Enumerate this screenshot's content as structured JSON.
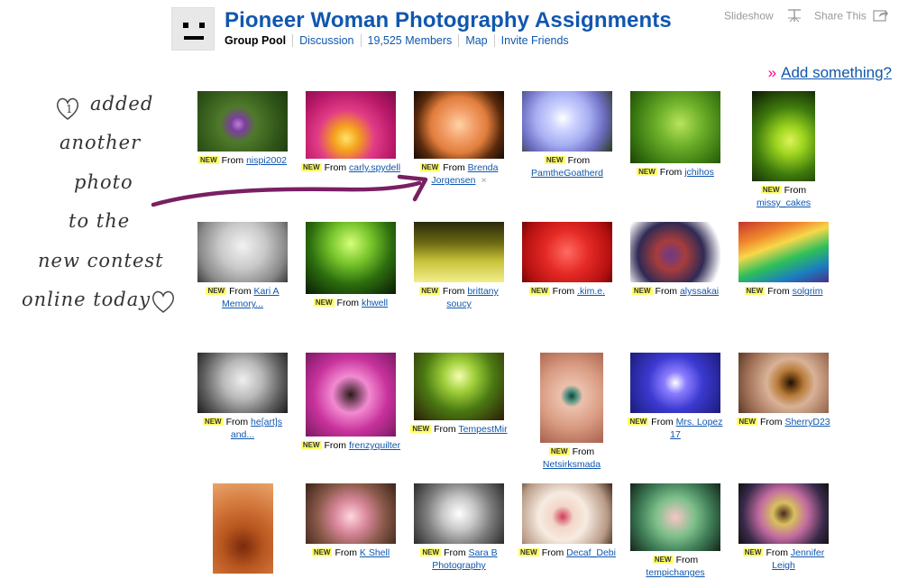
{
  "header": {
    "title": "Pioneer Woman Photography Assignments",
    "nav": [
      "Group Pool",
      "Discussion",
      "19,525 Members",
      "Map",
      "Invite Friends"
    ],
    "slideshow": "Slideshow",
    "share": "Share This"
  },
  "add_something": "Add something?",
  "handwritten_note": [
    "added",
    "another",
    "photo",
    "to the",
    "new contest",
    "online today"
  ],
  "labels": {
    "new": "NEW",
    "from": "From"
  },
  "photos": [
    {
      "user": "nispi2002"
    },
    {
      "user": "carly.spydell"
    },
    {
      "user": "Brenda Jorgensen"
    },
    {
      "user": "PamtheGoatherd"
    },
    {
      "user": "jchihos"
    },
    {
      "user": "missy_cakes"
    },
    {
      "user": "Kari A Memory..."
    },
    {
      "user": "khwell"
    },
    {
      "user": "brittany soucy"
    },
    {
      "user": ".kim.e."
    },
    {
      "user": "alyssakai"
    },
    {
      "user": "solgrim"
    },
    {
      "user": "he[art]s and..."
    },
    {
      "user": "frenzyquilter"
    },
    {
      "user": "TempestMir"
    },
    {
      "user": "Netsirksmada"
    },
    {
      "user": "Mrs. Lopez 17"
    },
    {
      "user": "SherryD23"
    },
    {
      "user": ""
    },
    {
      "user": "K Shell"
    },
    {
      "user": "Sara B Photography"
    },
    {
      "user": "Decaf_Debi"
    },
    {
      "user": "tempichanges"
    },
    {
      "user": "Jennifer Leigh"
    }
  ]
}
